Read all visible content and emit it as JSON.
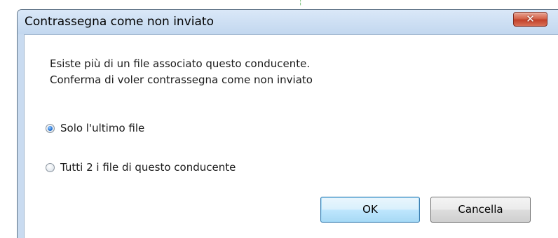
{
  "window": {
    "title": "Contrassegna come non inviato",
    "close_icon": "close-icon",
    "close_glyph": "✕"
  },
  "message": {
    "line1": "Esiste più di un file associato questo conducente.",
    "line2": "Conferma di voler contrassegna come non inviato"
  },
  "options": [
    {
      "label": "Solo l'ultimo file",
      "selected": true
    },
    {
      "label": "Tutti 2 i file di questo conducente",
      "selected": false
    }
  ],
  "buttons": {
    "ok_label": "OK",
    "cancel_label": "Cancella"
  },
  "colors": {
    "close_button": "#c2412a",
    "default_button_border": "#3c7fb1",
    "radio_selected": "#2a78d8"
  }
}
